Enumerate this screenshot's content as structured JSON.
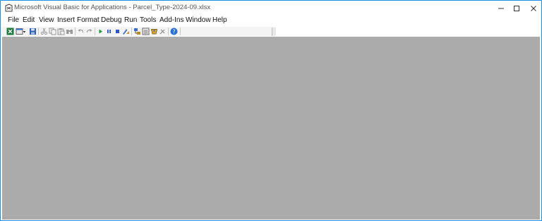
{
  "window": {
    "title": "Microsoft Visual Basic for Applications - Parcel_Type-2024-09.xlsx"
  },
  "menu": {
    "items": [
      {
        "id": "file",
        "label": "File"
      },
      {
        "id": "edit",
        "label": "Edit"
      },
      {
        "id": "view",
        "label": "View"
      },
      {
        "id": "insert",
        "label": "Insert"
      },
      {
        "id": "format",
        "label": "Format"
      },
      {
        "id": "debug",
        "label": "Debug"
      },
      {
        "id": "run",
        "label": "Run"
      },
      {
        "id": "tools",
        "label": "Tools"
      },
      {
        "id": "addins",
        "label": "Add-Ins"
      },
      {
        "id": "window",
        "label": "Window"
      },
      {
        "id": "help",
        "label": "Help"
      }
    ]
  },
  "toolbar": {
    "icons": [
      "excel-view-icon",
      "insert-userform-icon",
      "save-icon",
      "cut-icon",
      "copy-icon",
      "paste-icon",
      "find-icon",
      "undo-icon",
      "redo-icon",
      "run-icon",
      "break-icon",
      "reset-icon",
      "design-mode-icon",
      "project-explorer-icon",
      "properties-window-icon",
      "object-browser-icon",
      "toolbox-icon",
      "help-icon"
    ]
  },
  "colors": {
    "workspace": "#ababab",
    "window_border": "#1f8ee6",
    "help_icon": "#2a6fd6",
    "run_icon": "#1b9a3a",
    "reset_icon": "#2a55c9"
  }
}
